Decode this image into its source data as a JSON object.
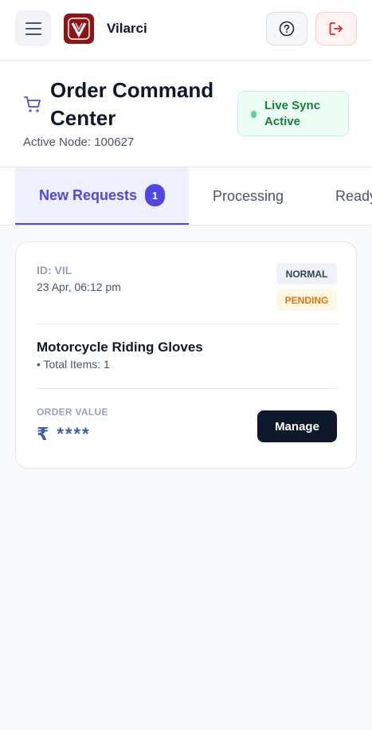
{
  "app": {
    "brand": "Vilarci",
    "logo_letters": "V"
  },
  "topbar": {
    "menu_icon": "hamburger-icon",
    "help_icon": "question-circle-icon",
    "logout_icon": "logout-icon"
  },
  "header": {
    "title": "Order Command Center",
    "node_label": "Active Node: 100627",
    "sync_status": "Live Sync Active",
    "icon": "cart-icon"
  },
  "tabs": [
    {
      "label": "New Requests",
      "count": "1",
      "active": true
    },
    {
      "label": "Processing",
      "active": false
    },
    {
      "label": "Ready",
      "active": false
    }
  ],
  "order": {
    "id": "ID: VIL",
    "date": "23 Apr, 06:12 pm",
    "priority": "NORMAL",
    "status": "PENDING",
    "product": "Motorcycle Riding Gloves",
    "items": "• Total Items: 1",
    "value_label": "ORDER VALUE",
    "value": "₹ ****",
    "manage_label": "Manage"
  },
  "colors": {
    "accent": "#4f46e5",
    "brand_logo": "#8f1414",
    "sync_green": "#15803d",
    "pending": "#d97706",
    "dark_button": "#0f172a"
  }
}
